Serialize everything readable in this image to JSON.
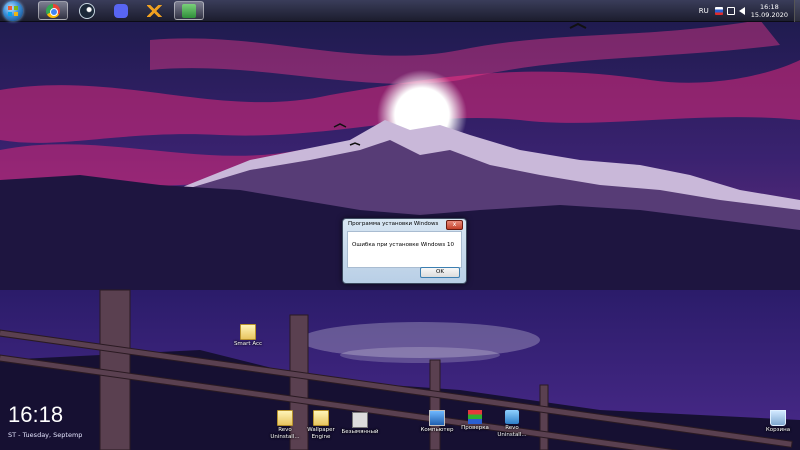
{
  "taskbar": {
    "start": "start-orb",
    "pinned": [
      {
        "name": "chrome",
        "active": true
      },
      {
        "name": "steam",
        "active": false
      },
      {
        "name": "discord",
        "active": false
      },
      {
        "name": "stalker",
        "active": false
      },
      {
        "name": "installer",
        "active": true
      }
    ],
    "tray": {
      "lang": "RU",
      "time": "16:18",
      "date": "15.09.2020"
    }
  },
  "dialog": {
    "title": "Программа установки Windows",
    "close_label": "x",
    "message": "Ошибка при установке Windows 10",
    "ok_label": "OK"
  },
  "widget": {
    "time": "16:18",
    "date": "ST - Tuesday, Septemp"
  },
  "desktop_icons": [
    {
      "label": "Smart Acc"
    },
    {
      "label": "Revo Uninstall..."
    },
    {
      "label": "Wallpaper Engine"
    },
    {
      "label": "Безымянный"
    },
    {
      "label": "Компьютер"
    },
    {
      "label": "Проверка"
    },
    {
      "label": "Revo Uninstall..."
    },
    {
      "label": "Корзина"
    }
  ]
}
